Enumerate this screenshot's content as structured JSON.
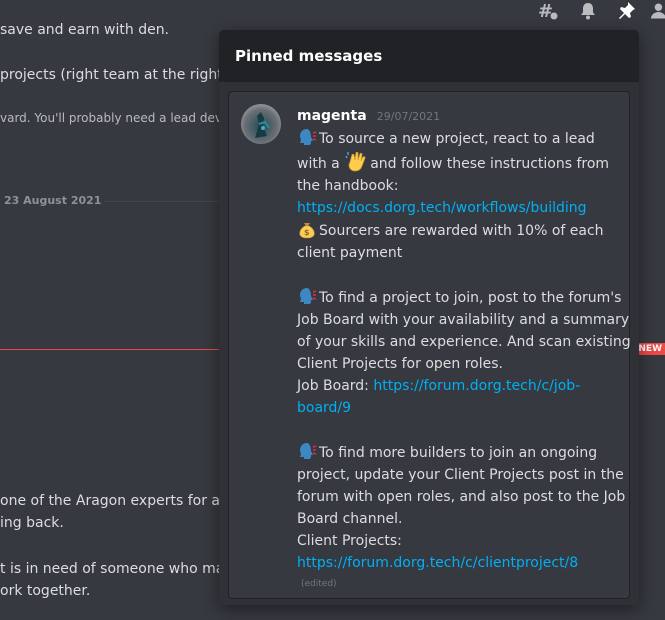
{
  "background": {
    "lines": [
      "save and earn with den.",
      "projects (right team at the right tin",
      "vard. You'll probably need a lead devel",
      "one of the Aragon experts for ass",
      "ing back.",
      "t is in need of someone who may l",
      "ork together."
    ],
    "date_divider": "23 August 2021",
    "new_badge": "NEW"
  },
  "topbar": {
    "icons": [
      "threads-icon",
      "bell-icon",
      "pin-icon",
      "members-icon"
    ]
  },
  "pinned": {
    "title": "Pinned messages",
    "message": {
      "author": "magenta",
      "timestamp": "29/07/2021",
      "p1": {
        "t1": "To source a new project, react to a lead",
        "t2a": "with a",
        "t2b": "and follow these instructions from",
        "t3": "the handbook:",
        "link": "https://docs.dorg.tech/workflows/building",
        "t5": "Sourcers are rewarded with 10% of each",
        "t6": "client payment"
      },
      "p2": {
        "t1": "To find a project to join, post to the forum's",
        "t2": "Job Board with your availability and a summary",
        "t3": "of your skills and experience. And scan existing",
        "t4": "Client Projects for open roles.",
        "label": "Job Board:",
        "link_a": "https://forum.dorg.tech/c/job-",
        "link_b": "board/9"
      },
      "p3": {
        "t1": "To find more builders to join an ongoing",
        "t2": "project, update your Client Projects post in the",
        "t3": "forum with open roles, and also post to the Job",
        "t4": "Board channel.",
        "label": "Client Projects:",
        "link": "https://forum.dorg.tech/c/clientproject/8"
      },
      "edited": "(edited)"
    }
  },
  "colors": {
    "background": "#36393f",
    "popup": "#2f3136",
    "header": "#202225",
    "link": "#00b0f4",
    "new_red": "#f04747"
  }
}
